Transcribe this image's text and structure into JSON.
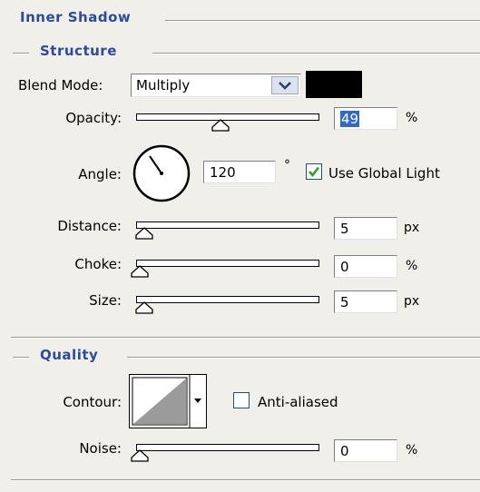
{
  "panel": {
    "title": "Inner Shadow",
    "structure_title": "Structure",
    "quality_title": "Quality"
  },
  "structure": {
    "blend_mode": {
      "label": "Blend Mode:",
      "value": "Multiply",
      "color": "#000000"
    },
    "opacity": {
      "label": "Opacity:",
      "value": "49",
      "unit": "%",
      "level_percent": 49
    },
    "angle": {
      "label": "Angle:",
      "value": "120",
      "unit": "°",
      "global_light_label": "Use Global Light",
      "global_light_checked": true
    },
    "distance": {
      "label": "Distance:",
      "value": "5",
      "unit": "px"
    },
    "choke": {
      "label": "Choke:",
      "value": "0",
      "unit": "%"
    },
    "size": {
      "label": "Size:",
      "value": "5",
      "unit": "px"
    }
  },
  "quality": {
    "contour": {
      "label": "Contour:",
      "anti_aliased_label": "Anti-aliased",
      "anti_aliased_checked": false
    },
    "noise": {
      "label": "Noise:",
      "value": "0",
      "unit": "%"
    }
  },
  "colors": {
    "section_title": "#2a4ba0",
    "background": "#f0efe9",
    "selection": "#316ac5",
    "check": "#2aa52a"
  }
}
